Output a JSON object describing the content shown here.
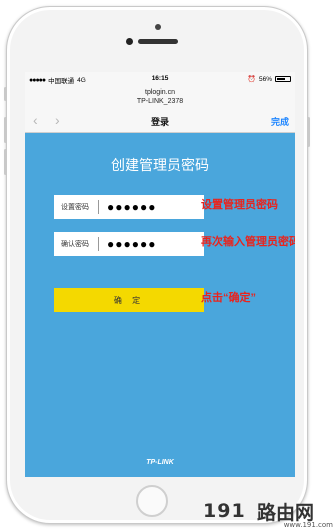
{
  "statusbar": {
    "signal": "●●●●●",
    "carrier": "中国联通",
    "network": "4G",
    "time": "16:15",
    "battery": "56%",
    "battery_level": 0.56
  },
  "urlbar": {
    "host": "tplogin.cn",
    "page": "TP-LINK_2378"
  },
  "navbar": {
    "back": "‹",
    "forward": "›",
    "title": "登录",
    "done": "完成"
  },
  "form": {
    "heading": "创建管理员密码",
    "password_label": "设置密码",
    "password_value": "●●●●●●",
    "confirm_label": "确认密码",
    "confirm_value": "●●●●●●",
    "submit": "确 定"
  },
  "annotations": {
    "set_password": "设置管理员密码",
    "repeat_password": "再次输入管理员密码",
    "click_confirm": "点击“确定”"
  },
  "brand": "TP-LINK",
  "watermark": {
    "number": "191",
    "name": "路由网",
    "site": "www.191.com"
  },
  "colors": {
    "screen_bg": "#4aa6dc",
    "button": "#f4d900",
    "annotation": "#e8241e",
    "link": "#1f86ff"
  }
}
